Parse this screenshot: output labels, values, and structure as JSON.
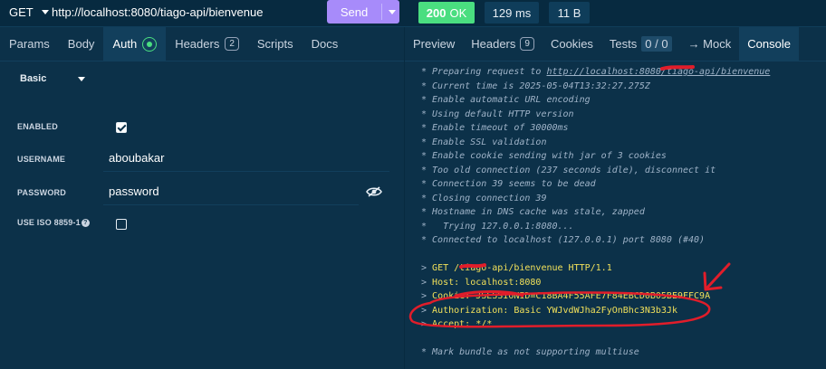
{
  "request": {
    "method": "GET",
    "url": "http://localhost:8080/tiago-api/bienvenue",
    "send_label": "Send"
  },
  "response": {
    "status_code": "200",
    "status_text": "OK",
    "time": "129 ms",
    "size": "11 B"
  },
  "left_tabs": [
    {
      "label": "Params"
    },
    {
      "label": "Body"
    },
    {
      "label": "Auth"
    },
    {
      "label": "Headers",
      "count": "2"
    },
    {
      "label": "Scripts"
    },
    {
      "label": "Docs"
    }
  ],
  "auth": {
    "type": "Basic",
    "enabled_label": "ENABLED",
    "enabled": true,
    "username_label": "USERNAME",
    "username": "aboubakar",
    "password_label": "PASSWORD",
    "password": "password",
    "iso_label": "USE ISO 8859-1",
    "iso_help": "?",
    "iso_enabled": false
  },
  "right_tabs": [
    {
      "label": "Preview"
    },
    {
      "label": "Headers",
      "count": "9"
    },
    {
      "label": "Cookies"
    },
    {
      "label": "Tests",
      "count": "0 / 0"
    },
    {
      "label": "→ Mock"
    },
    {
      "label": "Console"
    }
  ],
  "console": {
    "info": [
      "* Preparing request to ",
      "* Current time is 2025-05-04T13:32:27.275Z",
      "* Enable automatic URL encoding",
      "* Using default HTTP version",
      "* Enable timeout of 30000ms",
      "* Enable SSL validation",
      "* Enable cookie sending with jar of 3 cookies",
      "* Too old connection (237 seconds idle), disconnect it",
      "* Connection 39 seems to be dead",
      "* Closing connection 39",
      "* Hostname in DNS cache was stale, zapped",
      "*   Trying 127.0.0.1:8080...",
      "* Connected to localhost (127.0.0.1) port 8080 (#40)"
    ],
    "prep_url": "http://localhost:8080/tiago-api/bienvenue",
    "request_lines": [
      "GET /tiago-api/bienvenue HTTP/1.1",
      "Host: localhost:8080",
      "Cookie: JSESSIONID=C18BA4F55AFE7F84EBCD0B05BE9FFC9A",
      "Authorization: Basic YWJvdWJha2FyOnBhc3N3b3Jk",
      "Accept: */*"
    ],
    "footer": "* Mark bundle as not supporting multiuse"
  },
  "colors": {
    "background": "#0c3149",
    "send_button": "#a78bfa",
    "status_ok": "#4ade80",
    "request_text": "#f1e05a",
    "annotation": "#e11d2a"
  }
}
